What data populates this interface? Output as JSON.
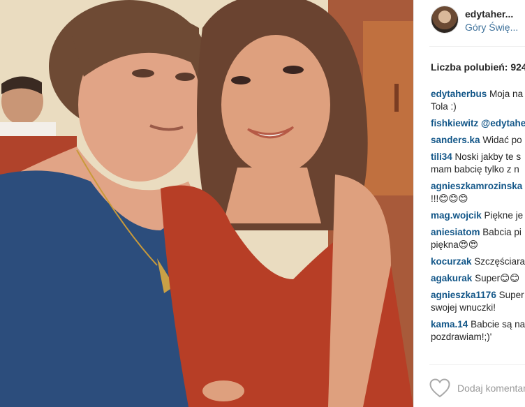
{
  "post": {
    "username": "edytaher...",
    "location": "Góry Świę...",
    "likes_text": "Liczba polubień: 924",
    "add_comment_placeholder": "Dodaj komentarz..."
  },
  "comments": [
    {
      "author": "edytaherbus",
      "text": "Moja na",
      "continuation": "Tola :)"
    },
    {
      "author": "fishkiewitz",
      "text": "@edytahe",
      "continuation": ""
    },
    {
      "author": "sanders.ka",
      "text": "Widać po",
      "continuation": ""
    },
    {
      "author": "tili34",
      "text": "Noski jakby te s",
      "continuation": "mam babcię tylko z n"
    },
    {
      "author": "agnieszkamrozinska",
      "text": "",
      "continuation": "!!!😊😊😊"
    },
    {
      "author": "mag.wojcik",
      "text": "Piękne je",
      "continuation": ""
    },
    {
      "author": "aniesiatom",
      "text": "Babcia pi",
      "continuation": "piękna😍😍"
    },
    {
      "author": "kocurzak",
      "text": "Szczęściara",
      "continuation": ""
    },
    {
      "author": "agakurak",
      "text": "Super😊😊",
      "continuation": ""
    },
    {
      "author": "agnieszka1176",
      "text": "Super",
      "continuation": "swojej wnuczki!"
    },
    {
      "author": "kama.14",
      "text": "Babcie są na",
      "continuation": "pozdrawiam!;)'"
    }
  ],
  "icons": {
    "like": "heart-icon"
  },
  "colors": {
    "author_link": "#125688",
    "location_link": "#3f729b",
    "placeholder": "#999999"
  }
}
